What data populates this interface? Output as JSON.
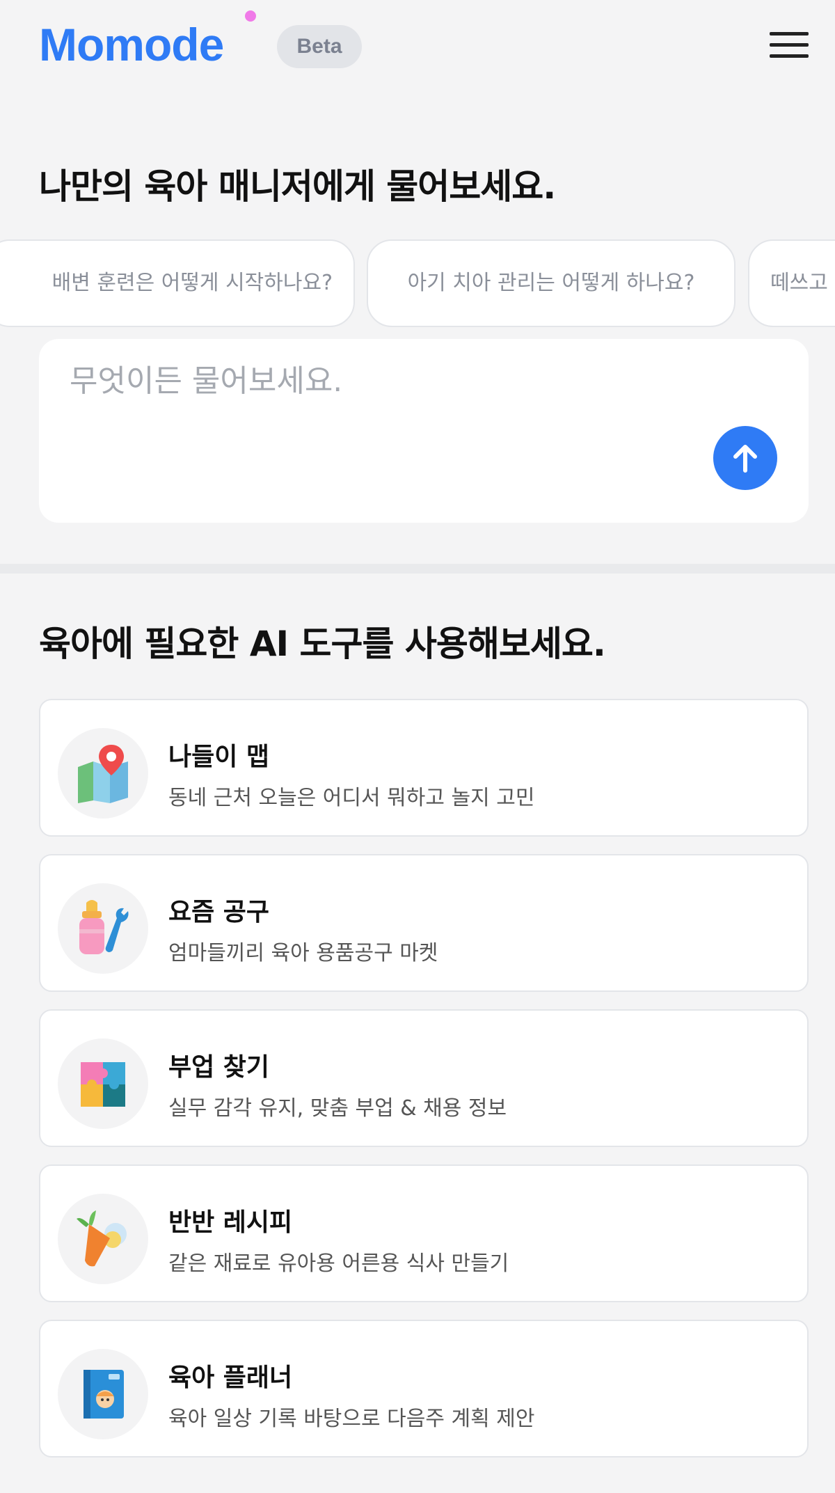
{
  "header": {
    "logo": "Momode",
    "badge": "Beta"
  },
  "ask": {
    "title": "나만의 육아 매니저에게 물어보세요.",
    "suggestions": [
      "배변 훈련은 어떻게 시작하나요?",
      "아기 치아 관리는 어떻게 하나요?",
      "떼쓰고"
    ],
    "input_placeholder": "무엇이든 물어보세요."
  },
  "tools": {
    "title": "육아에 필요한 AI 도구를 사용해보세요.",
    "items": [
      {
        "title": "나들이 맵",
        "desc": "동네 근처 오늘은 어디서 뭐하고 놀지 고민",
        "icon": "map-pin-icon"
      },
      {
        "title": "요즘 공구",
        "desc": "엄마들끼리 육아 용품공구 마켓",
        "icon": "bottle-wrench-icon"
      },
      {
        "title": "부업 찾기",
        "desc": "실무 감각 유지, 맞춤 부업 & 채용 정보",
        "icon": "puzzle-icon"
      },
      {
        "title": "반반 레시피",
        "desc": "같은 재료로 유아용 어른용 식사 만들기",
        "icon": "carrot-icon"
      },
      {
        "title": "육아 플래너",
        "desc": "육아 일상 기록 바탕으로 다음주 계획 제안",
        "icon": "planner-book-icon"
      }
    ]
  },
  "colors": {
    "accent": "#2f7bf5",
    "background": "#f4f4f5",
    "card": "#ffffff"
  }
}
